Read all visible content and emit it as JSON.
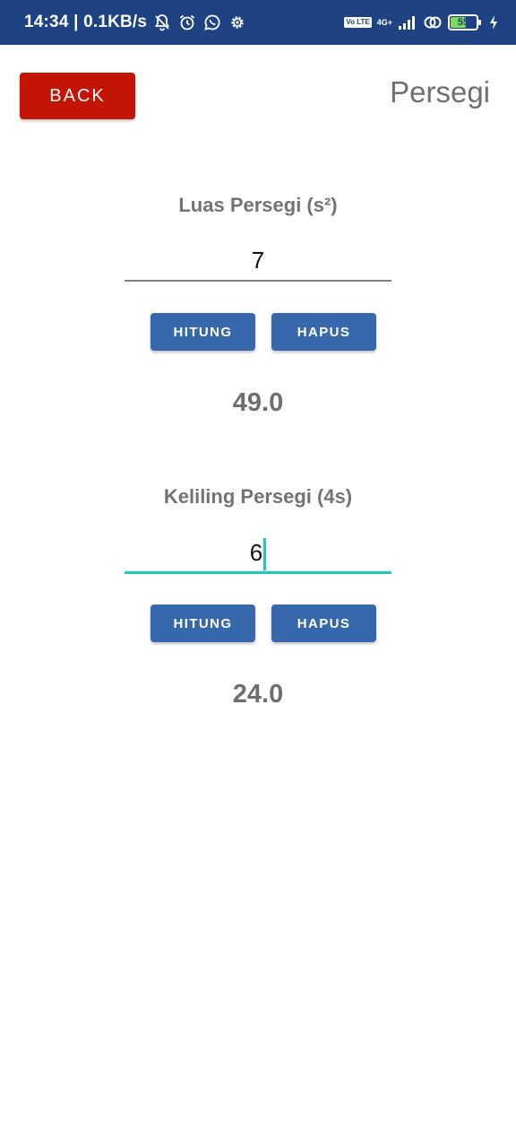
{
  "status_bar": {
    "time_speed": "14:34 | 0.1KB/s",
    "volte": "Vo LTE",
    "network": "4G+",
    "battery_level": "55",
    "icons": [
      "bell-off-icon",
      "alarm-icon",
      "whatsapp-icon",
      "gear-icon",
      "volte-icon",
      "signal-icon",
      "link-icon",
      "battery-icon",
      "charging-icon"
    ]
  },
  "header": {
    "back_label": "BACK",
    "title": "Persegi"
  },
  "luas": {
    "label": "Luas Persegi (s²)",
    "input_value": "7",
    "hitung_label": "HITUNG",
    "hapus_label": "HAPUS",
    "result": "49.0"
  },
  "keliling": {
    "label": "Keliling Persegi (4s)",
    "input_value": "6",
    "hitung_label": "HITUNG",
    "hapus_label": "HAPUS",
    "result": "24.0"
  },
  "colors": {
    "status_bar": "#1e4282",
    "back_button": "#c41405",
    "action_button": "#3668ab",
    "focus_underline": "#1fc9b7"
  }
}
